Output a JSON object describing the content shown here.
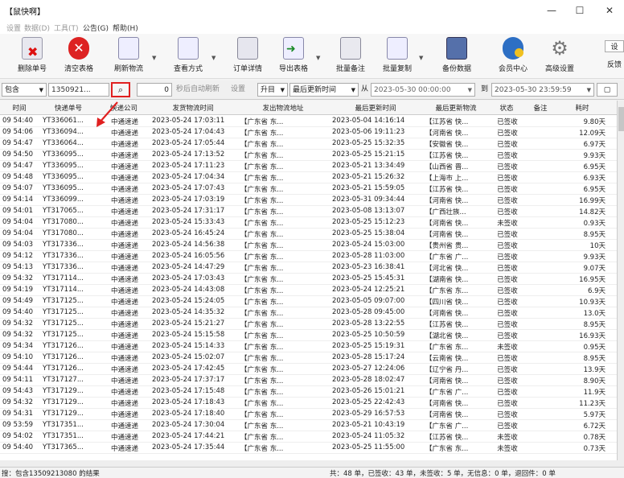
{
  "window": {
    "title": "【鼠快啊】"
  },
  "menu": [
    "设置",
    "数据(D)",
    "工具(T)",
    "公告(G)",
    "帮助(H)"
  ],
  "toolbar": [
    "删除单号",
    "清空表格",
    "刷新物流",
    "查看方式",
    "订单详情",
    "导出表格",
    "批量备注",
    "批量复制",
    "备份数据",
    "会员中心",
    "高级设置"
  ],
  "toolbar_right": [
    "设",
    "反馈"
  ],
  "filter": {
    "scope": "包含",
    "phone": "1350921...",
    "counter": "0",
    "refresh_hint": "秒后自动刷新",
    "setting": "设置",
    "order": "升目",
    "time_field": "最后更新时间",
    "from_label": "从",
    "from": "2023-05-30 00:00:00",
    "to_label": "到",
    "to": "2023-05-30 23:59:59"
  },
  "columns": [
    "时间",
    "快递单号",
    "快递公司",
    "发货物流时间",
    "发出物流地址",
    "最后更新时间",
    "最后更新物流",
    "状态",
    "备注",
    "耗时"
  ],
  "rows": [
    [
      "09 54:40",
      "YT336061...",
      "中通速递",
      "2023-05-24 17:03:11",
      "【广东省 东...",
      "2023-05-04 14:16:14",
      "【江苏省 快...",
      "已签收",
      "",
      "9.80天"
    ],
    [
      "09 54:06",
      "YT336094...",
      "中通速递",
      "2023-05-24 17:04:43",
      "【广东省 东...",
      "2023-05-06 19:11:23",
      "【河南省 快...",
      "已签收",
      "",
      "12.09天"
    ],
    [
      "09 54:47",
      "YT336064...",
      "中通速递",
      "2023-05-24 17:05:44",
      "【广东省 东...",
      "2023-05-25 15:32:35",
      "【安徽省 快...",
      "已签收",
      "",
      "6.97天"
    ],
    [
      "09 54:50",
      "YT336095...",
      "中通速递",
      "2023-05-24 17:13:52",
      "【广东省 东...",
      "2023-05-25 15:21:15",
      "【江苏省 快...",
      "已签收",
      "",
      "9.93天"
    ],
    [
      "09 54:47",
      "YT336095...",
      "中通速递",
      "2023-05-24 17:11:23",
      "【广东省 东...",
      "2023-05-21 13:34:49",
      "【山西省 晋...",
      "已签收",
      "",
      "6.95天"
    ],
    [
      "09 54:48",
      "YT336095...",
      "中通速递",
      "2023-05-24 17:04:34",
      "【广东省 东...",
      "2023-05-21 15:26:32",
      "【上海市 上...",
      "已签收",
      "",
      "6.93天"
    ],
    [
      "09 54:07",
      "YT336095...",
      "中通速递",
      "2023-05-24 17:07:43",
      "【广东省 东...",
      "2023-05-21 15:59:05",
      "【江苏省 快...",
      "已签收",
      "",
      "6.95天"
    ],
    [
      "09 54:14",
      "YT336099...",
      "中通速递",
      "2023-05-24 17:03:19",
      "【广东省 东...",
      "2023-05-31 09:34:44",
      "【河南省 快...",
      "已签收",
      "",
      "16.99天"
    ],
    [
      "09 54:01",
      "YT317065...",
      "中通速递",
      "2023-05-24 17:31:17",
      "【广东省 东...",
      "2023-05-08 13:13:07",
      "【广西壮族...",
      "已签收",
      "",
      "14.82天"
    ],
    [
      "09 54:04",
      "YT317080...",
      "中通速递",
      "2023-05-24 15:33:43",
      "【广东省 东...",
      "2023-05-25 15:12:23",
      "【河南省 快...",
      "未签收",
      "",
      "0.93天"
    ],
    [
      "09 54:04",
      "YT317080...",
      "中通速递",
      "2023-05-24 16:45:24",
      "【广东省 东...",
      "2023-05-25 15:38:04",
      "【河南省 快...",
      "已签收",
      "",
      "8.95天"
    ],
    [
      "09 54:03",
      "YT317336...",
      "中通速递",
      "2023-05-24 14:56:38",
      "【广东省 东...",
      "2023-05-24 15:03:00",
      "【贵州省 贵...",
      "已签收",
      "",
      "10天"
    ],
    [
      "09 54:12",
      "YT317336...",
      "中通速递",
      "2023-05-24 16:05:56",
      "【广东省 东...",
      "2023-05-28 11:03:00",
      "【广东省 广...",
      "已签收",
      "",
      "9.93天"
    ],
    [
      "09 54:13",
      "YT317336...",
      "中通速递",
      "2023-05-24 14:47:29",
      "【广东省 东...",
      "2023-05-23 16:38:41",
      "【河北省 快...",
      "已签收",
      "",
      "9.07天"
    ],
    [
      "09 54:32",
      "YT317114...",
      "中通速递",
      "2023-05-24 17:03:43",
      "【广东省 东...",
      "2023-05-25 15:45:31",
      "【湖南省 快...",
      "已签收",
      "",
      "16.95天"
    ],
    [
      "09 54:19",
      "YT317114...",
      "中通速递",
      "2023-05-24 14:43:08",
      "【广东省 东...",
      "2023-05-24 12:25:21",
      "【广东省 东...",
      "已签收",
      "",
      "6.9天"
    ],
    [
      "09 54:49",
      "YT317125...",
      "中通速递",
      "2023-05-24 15:24:05",
      "【广东省 东...",
      "2023-05-05 09:07:00",
      "【四川省 快...",
      "已签收",
      "",
      "10.93天"
    ],
    [
      "09 54:40",
      "YT317125...",
      "中通速递",
      "2023-05-24 14:35:32",
      "【广东省 东...",
      "2023-05-28 09:45:00",
      "【河南省 快...",
      "已签收",
      "",
      "13.0天"
    ],
    [
      "09 54:32",
      "YT317125...",
      "中通速递",
      "2023-05-24 15:21:27",
      "【广东省 东...",
      "2023-05-28 13:22:55",
      "【江苏省 快...",
      "已签收",
      "",
      "8.95天"
    ],
    [
      "09 54:32",
      "YT317125...",
      "中通速递",
      "2023-05-24 15:15:58",
      "【广东省 东...",
      "2023-05-25 10:50:59",
      "【湖北省 快...",
      "已签收",
      "",
      "16.93天"
    ],
    [
      "09 54:34",
      "YT317126...",
      "中通速递",
      "2023-05-24 15:14:33",
      "【广东省 东...",
      "2023-05-25 15:19:31",
      "【广东省 东...",
      "未签收",
      "",
      "0.95天"
    ],
    [
      "09 54:10",
      "YT317126...",
      "中通速递",
      "2023-05-24 15:02:07",
      "【广东省 东...",
      "2023-05-28 15:17:24",
      "【云南省 快...",
      "已签收",
      "",
      "8.95天"
    ],
    [
      "09 54:44",
      "YT317126...",
      "中通速递",
      "2023-05-24 17:42:45",
      "【广东省 东...",
      "2023-05-27 12:24:06",
      "【辽宁省 丹...",
      "已签收",
      "",
      "13.9天"
    ],
    [
      "09 54:11",
      "YT317127...",
      "中通速递",
      "2023-05-24 17:37:17",
      "【广东省 东...",
      "2023-05-28 18:02:47",
      "【河南省 快...",
      "已签收",
      "",
      "8.90天"
    ],
    [
      "09 54:43",
      "YT317129...",
      "中通速递",
      "2023-05-24 17:15:48",
      "【广东省 东...",
      "2023-05-26 15:01:21",
      "【广东省 广...",
      "已签收",
      "",
      "11.9天"
    ],
    [
      "09 54:32",
      "YT317129...",
      "中通速递",
      "2023-05-24 17:18:43",
      "【广东省 东...",
      "2023-05-25 22:42:43",
      "【河南省 快...",
      "已签收",
      "",
      "11.23天"
    ],
    [
      "09 54:31",
      "YT317129...",
      "中通速递",
      "2023-05-24 17:18:40",
      "【广东省 东...",
      "2023-05-29 16:57:53",
      "【河南省 快...",
      "已签收",
      "",
      "5.97天"
    ],
    [
      "09 53:59",
      "YT317351...",
      "中通速递",
      "2023-05-24 17:30:04",
      "【广东省 东...",
      "2023-05-21 10:43:19",
      "【广东省 广...",
      "已签收",
      "",
      "6.72天"
    ],
    [
      "09 54:02",
      "YT317351...",
      "中通速递",
      "2023-05-24 17:44:21",
      "【广东省 东...",
      "2023-05-24 11:05:32",
      "【江苏省 快...",
      "未签收",
      "",
      "0.78天"
    ],
    [
      "09 54:40",
      "YT317365...",
      "中通速递",
      "2023-05-24 17:35:44",
      "【广东省 东...",
      "2023-05-25 11:55:00",
      "【广东省 东...",
      "未签收",
      "",
      "0.73天"
    ]
  ],
  "status": {
    "left": "搜：包含13509213080 的结果",
    "right": "共：48 单，已签收：43 单，未签收：5 单，无信息：0 单，退回件：0 单"
  }
}
